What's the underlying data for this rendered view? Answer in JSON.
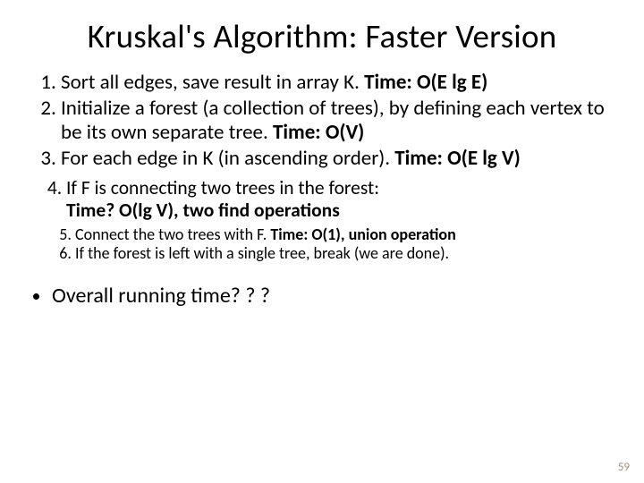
{
  "title": "Kruskal's Algorithm: Faster Version",
  "items": {
    "l1": {
      "n1": {
        "text": "Sort all edges, save result in array K. ",
        "bold": "Time: O(E lg E)"
      },
      "n2": {
        "text": "Initialize a forest (a collection of trees), by defining each vertex to be its own separate tree. ",
        "bold": "Time: O(V)"
      },
      "n3": {
        "text": "For each edge in K (in ascending order). ",
        "bold": "Time: O(E lg V)"
      }
    },
    "l2": {
      "n4": {
        "text": "If F is connecting two trees in the forest: ",
        "bold": "Time? O(lg V), two find operations"
      }
    },
    "l3": {
      "n5": {
        "text": "Connect the two trees with F. ",
        "bold": "Time: O(1), union operation"
      },
      "n6": {
        "text": "If the forest is left with a single tree, break (we are done)."
      }
    }
  },
  "bullet": "Overall running time? ? ?",
  "page": "59"
}
